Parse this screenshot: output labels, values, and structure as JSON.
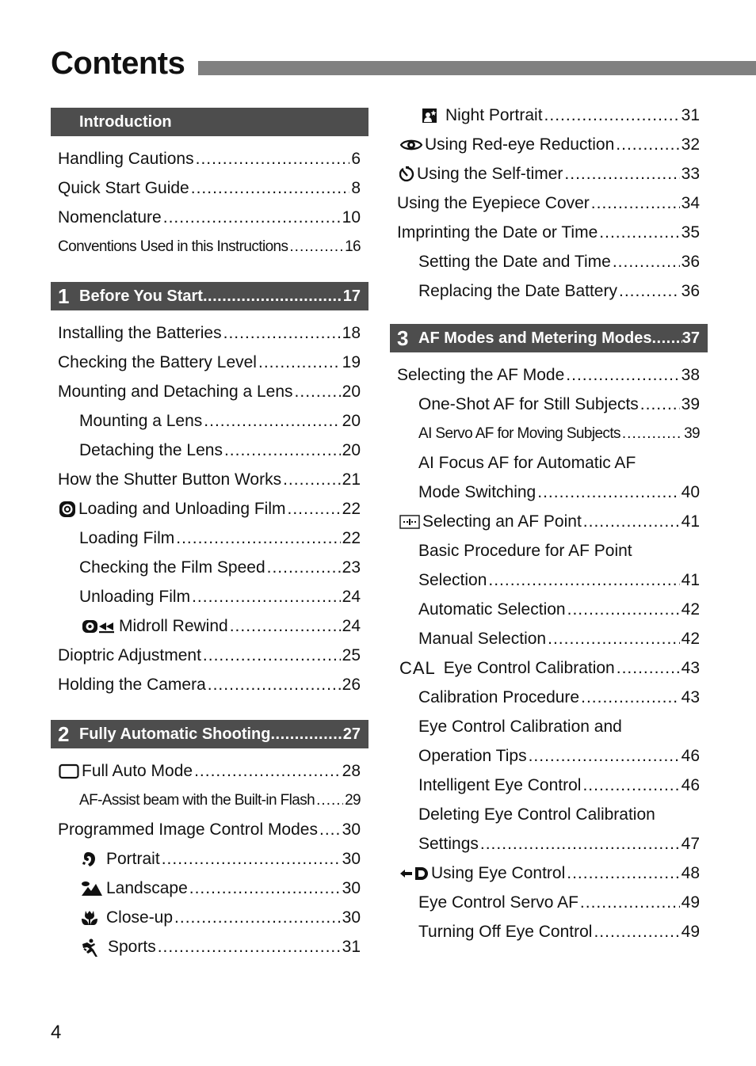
{
  "page": {
    "title": "Contents",
    "page_number": "4"
  },
  "left_column": {
    "intro": {
      "header": "Introduction",
      "entries": [
        {
          "text": "Handling Cautions",
          "page": "6"
        },
        {
          "text": "Quick Start Guide",
          "page": "8"
        },
        {
          "text": "Nomenclature",
          "page": "10"
        },
        {
          "text": "Conventions Used in this Instructions",
          "page": "16"
        }
      ]
    },
    "chapter1": {
      "number": "1",
      "header": "Before You Start",
      "page": "17",
      "entries": [
        {
          "text": "Installing the Batteries",
          "page": "18"
        },
        {
          "text": "Checking the Battery Level",
          "page": "19"
        },
        {
          "text": "Mounting and Detaching a Lens",
          "page": "20"
        },
        {
          "text": "Mounting a Lens",
          "page": "20"
        },
        {
          "text": "Detaching the Lens",
          "page": "20"
        },
        {
          "text": "How the Shutter Button Works",
          "page": "21"
        },
        {
          "text": "Loading and Unloading Film",
          "page": "22",
          "icon": "film-load-icon"
        },
        {
          "text": "Loading Film",
          "page": "22"
        },
        {
          "text": "Checking the Film Speed",
          "page": "23"
        },
        {
          "text": "Unloading Film",
          "page": "24"
        },
        {
          "text": "Midroll Rewind",
          "page": "24",
          "icon": "midroll-rewind-icon"
        },
        {
          "text": "Dioptric Adjustment",
          "page": "25"
        },
        {
          "text": "Holding the Camera",
          "page": "26"
        }
      ]
    },
    "chapter2": {
      "number": "2",
      "header": "Fully Automatic Shooting",
      "page": "27",
      "entries": [
        {
          "text": "Full Auto Mode",
          "page": "28",
          "icon": "full-auto-icon"
        },
        {
          "text": "AF-Assist beam with the Built-in Flash",
          "page": "29"
        },
        {
          "text": "Programmed Image Control Modes",
          "page": "30"
        },
        {
          "text": "Portrait",
          "page": "30",
          "icon": "portrait-icon"
        },
        {
          "text": "Landscape",
          "page": "30",
          "icon": "landscape-icon"
        },
        {
          "text": "Close-up",
          "page": "30",
          "icon": "close-up-icon"
        },
        {
          "text": "Sports",
          "page": "31",
          "icon": "sports-icon"
        }
      ]
    }
  },
  "right_column": {
    "cont_entries": [
      {
        "text": "Night Portrait",
        "page": "31",
        "icon": "night-portrait-icon"
      },
      {
        "text": "Using Red-eye Reduction",
        "page": "32",
        "icon": "red-eye-icon"
      },
      {
        "text": "Using the Self-timer",
        "page": "33",
        "icon": "self-timer-icon"
      },
      {
        "text": "Using the Eyepiece Cover",
        "page": "34"
      },
      {
        "text": "Imprinting the Date or Time",
        "page": "35"
      },
      {
        "text": "Setting the Date and Time",
        "page": "36"
      },
      {
        "text": "Replacing the Date Battery",
        "page": "36"
      }
    ],
    "chapter3": {
      "number": "3",
      "header": "AF Modes and Metering Modes",
      "page": "37",
      "entries": [
        {
          "text": "Selecting the AF Mode",
          "page": "38"
        },
        {
          "text": "One-Shot AF for Still Subjects",
          "page": "39"
        },
        {
          "text": "AI Servo AF for Moving Subjects",
          "page": "39"
        },
        {
          "text": "AI Focus AF for Automatic AF",
          "page": ""
        },
        {
          "text": "Mode Switching",
          "page": "40"
        },
        {
          "text": "Selecting an AF Point",
          "page": "41",
          "icon": "af-point-icon"
        },
        {
          "text": "Basic Procedure for AF Point",
          "page": ""
        },
        {
          "text": "Selection",
          "page": "41"
        },
        {
          "text": "Automatic Selection",
          "page": "42"
        },
        {
          "text": "Manual Selection",
          "page": "42"
        },
        {
          "text": "Eye Control Calibration",
          "page": "43",
          "icon_text": "CAL"
        },
        {
          "text": "Calibration Procedure",
          "page": "43"
        },
        {
          "text": "Eye Control Calibration and",
          "page": ""
        },
        {
          "text": "Operation Tips",
          "page": "46"
        },
        {
          "text": "Intelligent Eye Control",
          "page": "46"
        },
        {
          "text": "Deleting Eye Control Calibration",
          "page": ""
        },
        {
          "text": "Settings",
          "page": "47"
        },
        {
          "text": "Using Eye Control",
          "page": "48",
          "icon": "eye-control-icon"
        },
        {
          "text": "Eye Control Servo AF",
          "page": "49"
        },
        {
          "text": "Turning Off Eye Control",
          "page": "49"
        }
      ]
    }
  }
}
